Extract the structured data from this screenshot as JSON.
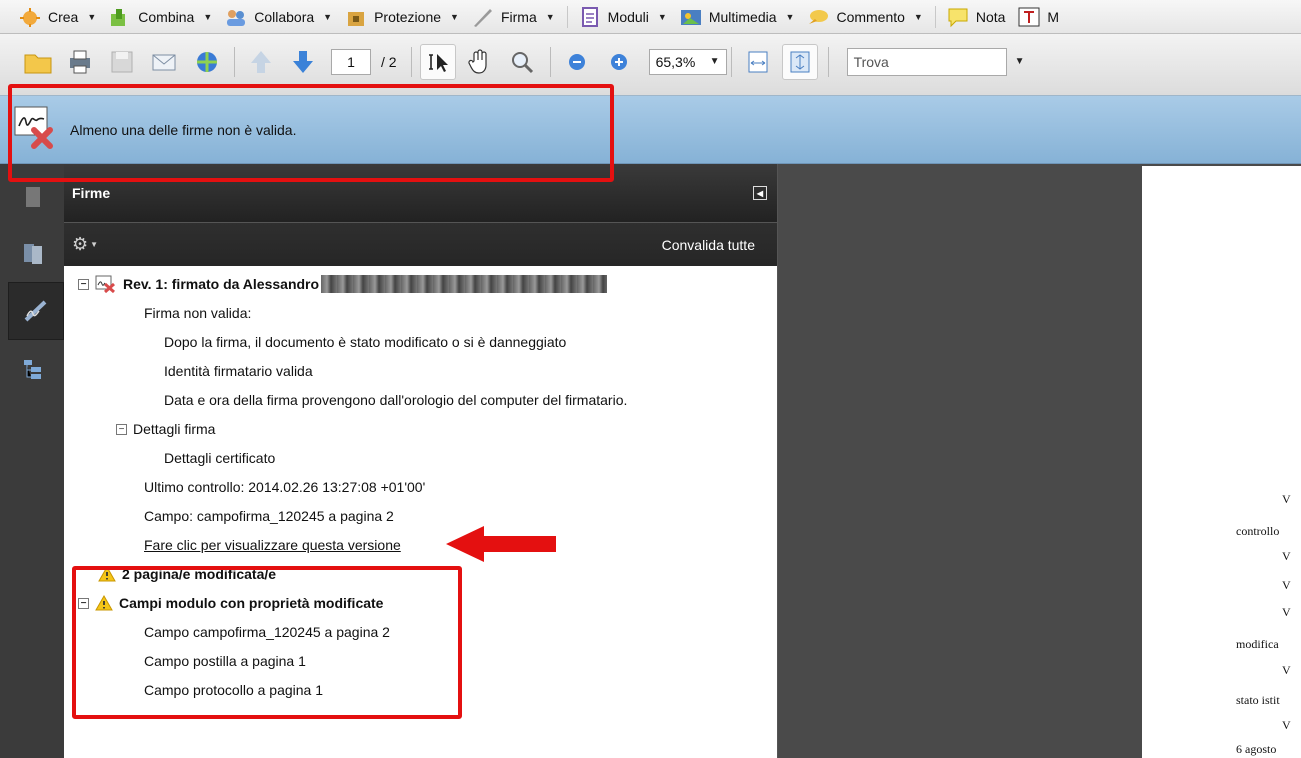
{
  "menubar": {
    "items": [
      {
        "label": "Crea",
        "icon": "create-icon",
        "caret": true
      },
      {
        "label": "Combina",
        "icon": "combine-icon",
        "caret": true
      },
      {
        "label": "Collabora",
        "icon": "collaborate-icon",
        "caret": true
      },
      {
        "label": "Protezione",
        "icon": "lock-icon",
        "caret": true
      },
      {
        "label": "Firma",
        "icon": "pen-icon",
        "caret": true
      },
      {
        "label": "Moduli",
        "icon": "forms-icon",
        "caret": true
      },
      {
        "label": "Multimedia",
        "icon": "multimedia-icon",
        "caret": true
      },
      {
        "label": "Commento",
        "icon": "comment-icon",
        "caret": true
      },
      {
        "label": "Nota",
        "icon": "note-icon",
        "caret": false
      },
      {
        "label": "M",
        "icon": "text-tool-icon",
        "caret": false
      }
    ]
  },
  "toolbar": {
    "page_current": "1",
    "page_total": "/ 2",
    "zoom": "65,3%",
    "find_placeholder": "Trova"
  },
  "message": {
    "text": "Almeno una delle firme non è valida."
  },
  "panel": {
    "title": "Firme",
    "validate_all": "Convalida tutte",
    "tree": {
      "rev_title": "Rev. 1: firmato da Alessandro",
      "invalid": "Firma non valida:",
      "modified": "Dopo la firma, il documento è stato modificato o si è danneggiato",
      "identity": "Identità firmatario valida",
      "datetime": "Data e ora della firma provengono dall'orologio del computer del firmatario.",
      "details": "Dettagli firma",
      "cert_details": "Dettagli certificato",
      "last_check": "Ultimo controllo: 2014.02.26 13:27:08 +01'00'",
      "field": "Campo: campofirma_120245 a pagina 2",
      "view_version": "Fare clic per visualizzare questa versione",
      "pages_modified": "2 pagina/e modificata/e",
      "form_fields_modified": "Campi modulo con proprietà modificate",
      "field1": "Campo campofirma_120245 a pagina 2",
      "field2": "Campo postilla a pagina 1",
      "field3": "Campo protocollo a pagina 1"
    }
  },
  "document": {
    "lines": [
      "V",
      "controllo",
      "V",
      "V",
      "V",
      "modifica",
      "V",
      "stato istit",
      "V",
      "6 agosto"
    ]
  },
  "colors": {
    "annotation_red": "#e41010",
    "message_bar": "#a9cbe7",
    "panel_header": "#2a2a2a"
  }
}
